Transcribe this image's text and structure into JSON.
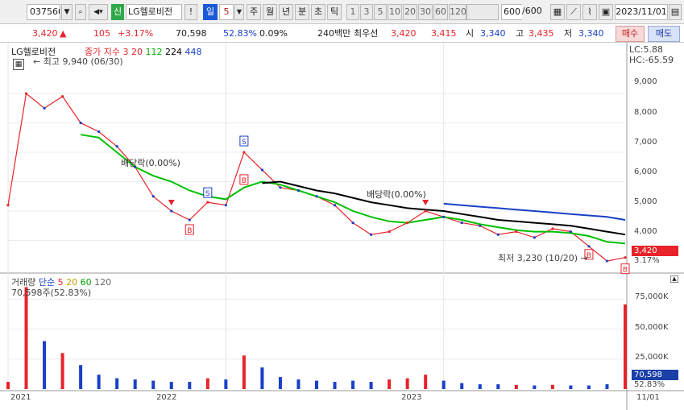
{
  "toolbar": {
    "code": "037560",
    "type_badge": "신",
    "name": "LG헬로비전",
    "excl": "!",
    "period_day": "일",
    "period_num": "5",
    "periods": [
      "주",
      "월",
      "년",
      "분",
      "초",
      "틱"
    ],
    "mins": [
      "1",
      "3",
      "5",
      "10",
      "20",
      "30",
      "60",
      "120"
    ],
    "count": "600",
    "count_total": "/600",
    "date": "2023/11/01"
  },
  "quote": {
    "price": "3,420",
    "change": "105",
    "change_pct": "+3.17%",
    "volume": "70,598",
    "vol_ratio": "52.83%",
    "turnover": "0.09%",
    "amount": "240백만",
    "best_ask_label": "최우선",
    "best_ask": "3,420",
    "best_bid": "3,415",
    "open_label": "시",
    "open": "3,340",
    "high_label": "고",
    "high": "3,435",
    "low_label": "저",
    "low": "3,340",
    "buy_label": "매수",
    "sell_label": "매도"
  },
  "colors": {
    "up": "#e8232a",
    "down": "#1a40c8",
    "ma3": "#e8232a",
    "ma20": "#c8c800",
    "ma112": "#00c000",
    "ma224": "#000000",
    "ma448": "#1a40c8"
  },
  "price_panel": {
    "title": "LG헬로비전",
    "legend_main": "종가 지수 3",
    "legend_ma": [
      "20",
      "112",
      "224",
      "448"
    ],
    "lc_label": "LC:5.88",
    "hc_label": "HC:-65.59",
    "max_label": "최고 9,940 (06/30)",
    "min_label": "최저 3,230 (10/20)",
    "dividend_labels": [
      "배당락(0.00%)",
      "배당락(0.00%)"
    ],
    "y_ticks": [
      "9,000",
      "8,000",
      "7,000",
      "6,000",
      "5,000",
      "4,000"
    ],
    "last_price": "3,420",
    "last_pct": "3.17%"
  },
  "volume_panel": {
    "title": "거래량",
    "legend_main": "단순",
    "legend_ma": [
      "5",
      "20",
      "60",
      "120"
    ],
    "current": "70,598주(52.83%)",
    "y_ticks": [
      "75,000K",
      "50,000K",
      "25,000K"
    ],
    "last_volume": "70,598",
    "last_pct": "52.83%"
  },
  "x_axis": [
    "2021",
    "2022",
    "2023",
    "11/01"
  ],
  "chart_data": {
    "type": "line",
    "title": "LG헬로비전",
    "x": [
      "2021-01",
      "2021-02",
      "2021-03",
      "2021-04",
      "2021-05",
      "2021-06",
      "2021-07",
      "2021-08",
      "2021-09",
      "2021-10",
      "2021-11",
      "2021-12",
      "2022-01",
      "2022-02",
      "2022-03",
      "2022-04",
      "2022-05",
      "2022-06",
      "2022-07",
      "2022-08",
      "2022-09",
      "2022-10",
      "2022-11",
      "2022-12",
      "2023-01",
      "2023-02",
      "2023-03",
      "2023-04",
      "2023-05",
      "2023-06",
      "2023-07",
      "2023-08",
      "2023-09",
      "2023-10",
      "2023-11"
    ],
    "series": [
      {
        "name": "종가",
        "values": [
          5200,
          9000,
          8500,
          8900,
          8000,
          7700,
          7200,
          6500,
          5500,
          5000,
          4700,
          5300,
          5200,
          7000,
          6400,
          5800,
          5700,
          5500,
          5200,
          4600,
          4200,
          4300,
          4600,
          5000,
          4800,
          4600,
          4500,
          4200,
          4300,
          4100,
          4400,
          4300,
          3800,
          3300,
          3420
        ]
      },
      {
        "name": "112",
        "values": [
          null,
          null,
          null,
          null,
          7600,
          7500,
          7000,
          6500,
          6200,
          6000,
          5700,
          5500,
          5400,
          5800,
          6000,
          5900,
          5700,
          5500,
          5300,
          5000,
          4800,
          4650,
          4600,
          4700,
          4800,
          4700,
          4550,
          4450,
          4350,
          4300,
          4300,
          4250,
          4150,
          3950,
          3900
        ]
      },
      {
        "name": "224",
        "values": [
          null,
          null,
          null,
          null,
          null,
          null,
          null,
          null,
          null,
          null,
          null,
          null,
          null,
          null,
          5950,
          6000,
          5850,
          5700,
          5600,
          5450,
          5300,
          5200,
          5100,
          5050,
          5000,
          4900,
          4800,
          4700,
          4650,
          4600,
          4550,
          4500,
          4400,
          4300,
          4200
        ]
      },
      {
        "name": "448",
        "values": [
          null,
          null,
          null,
          null,
          null,
          null,
          null,
          null,
          null,
          null,
          null,
          null,
          null,
          null,
          null,
          null,
          null,
          null,
          null,
          null,
          null,
          null,
          null,
          null,
          5250,
          5200,
          5150,
          5100,
          5050,
          5000,
          4950,
          4900,
          4850,
          4800,
          4700
        ]
      }
    ],
    "volume": [
      6000,
      85000,
      40000,
      30000,
      20000,
      12000,
      9000,
      8000,
      7000,
      6000,
      6000,
      9000,
      8000,
      28000,
      18000,
      10000,
      8000,
      7000,
      6000,
      7000,
      6000,
      8000,
      9000,
      12000,
      7000,
      5000,
      4000,
      4000,
      3500,
      3000,
      3500,
      3000,
      3000,
      4000,
      70598
    ],
    "ylim": [
      3000,
      10400
    ],
    "ylabel": "",
    "xlabel": ""
  }
}
